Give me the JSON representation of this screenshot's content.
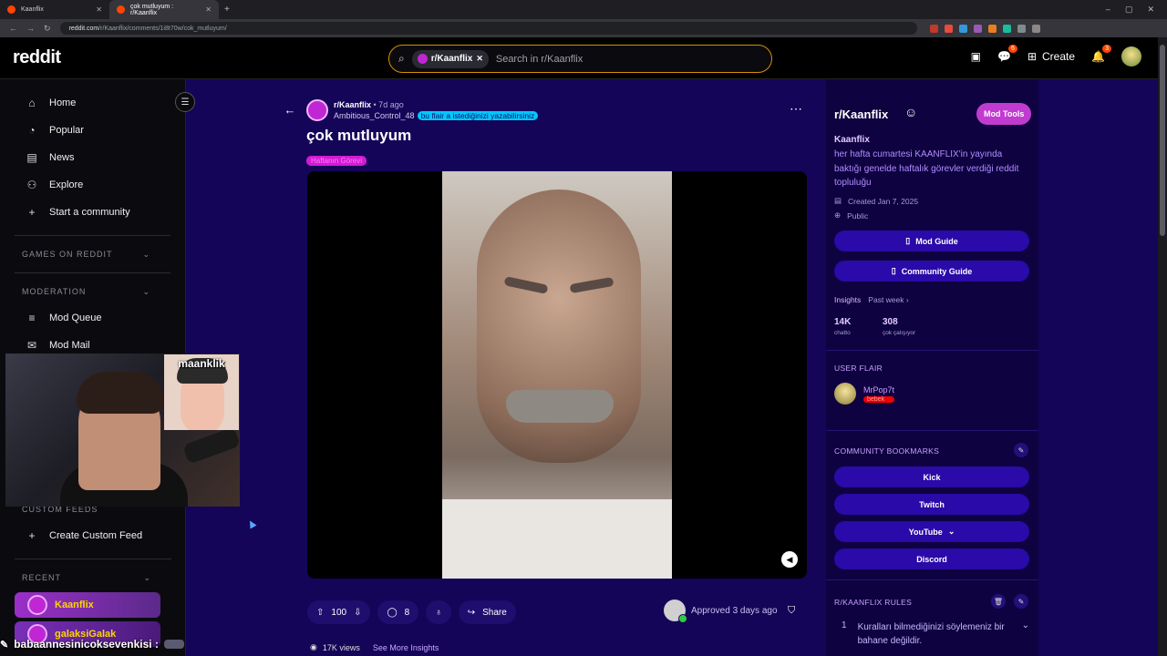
{
  "browser": {
    "tabs": [
      {
        "label": "Kaanflix",
        "active": false
      },
      {
        "label": "çok mutluyum : r/Kaanflix",
        "active": true
      }
    ],
    "url_host": "reddit.com",
    "url_path": "/r/Kaanflix/comments/1i8t70w/cok_mutluyum/"
  },
  "header": {
    "logo": "reddit",
    "search_chip": "r/Kaanflix",
    "search_placeholder": "Search in r/Kaanflix",
    "chat_badge": "6",
    "create_label": "Create",
    "notif_badge": "3"
  },
  "sidebar": {
    "nav": [
      {
        "label": "Home",
        "icon": "home-icon"
      },
      {
        "label": "Popular",
        "icon": "popular-icon"
      },
      {
        "label": "News",
        "icon": "news-icon"
      },
      {
        "label": "Explore",
        "icon": "explore-icon"
      },
      {
        "label": "Start a community",
        "icon": "plus-icon"
      }
    ],
    "games_heading": "GAMES ON REDDIT",
    "moderation_heading": "MODERATION",
    "mod_items": [
      "Mod Queue",
      "Mod Mail"
    ],
    "custom_feeds_heading": "CUSTOM FEEDS",
    "create_custom_feed": "Create Custom Feed",
    "recent_heading": "RECENT",
    "recent_items": [
      "Kaanflix",
      "galaksiGalak"
    ]
  },
  "webcam": {
    "overlay_label": "maanklik"
  },
  "post": {
    "subreddit": "r/Kaanflix",
    "age": "• 7d ago",
    "author": "Ambitious_Control_48",
    "author_flair": "bu flair a istediğinizi yazabilirsiniz",
    "title": "çok mutluyum",
    "post_flair": "Haftanın Görevi",
    "votes": "100",
    "comments": "8",
    "share_label": "Share",
    "approved_text": "Approved 3 days ago",
    "views": "17K views",
    "see_more": "See More Insights"
  },
  "community": {
    "title": "r/Kaanflix",
    "mod_tools": "Mod Tools",
    "name": "Kaanflix",
    "description": "her hafta cumartesi KAANFLIX'in yayında baktığı genelde haftalık görevler verdiği reddit topluluğu",
    "created": "Created Jan 7, 2025",
    "visibility": "Public",
    "mod_guide": "Mod Guide",
    "community_guide": "Community Guide",
    "insights_label": "Insights",
    "insights_period": "Past week ›",
    "stats": [
      {
        "value": "14K",
        "label": "chatto"
      },
      {
        "value": "308",
        "label": "çok çalışıyor"
      }
    ],
    "user_flair_heading": "USER FLAIR",
    "user_flair_name": "MrPop7t",
    "user_flair_badge": "bebek",
    "bookmarks_heading": "COMMUNITY BOOKMARKS",
    "bookmarks": [
      "Kick",
      "Twitch",
      "YouTube",
      "Discord"
    ],
    "rules_heading": "R/KAANFLIX RULES",
    "rule_1_num": "1",
    "rule_1_text": "Kuralları bilmediğinizi söylemeniz bir bahane değildir."
  },
  "chat_overlay": {
    "text": "babaannesinicoksevenkisi :"
  },
  "colors": {
    "post_bg": "#140558",
    "right_panel_bg": "#0e0340",
    "accent_purple": "#c13bd0",
    "button_blue": "#2a0aa8",
    "search_border": "#d68f00"
  }
}
